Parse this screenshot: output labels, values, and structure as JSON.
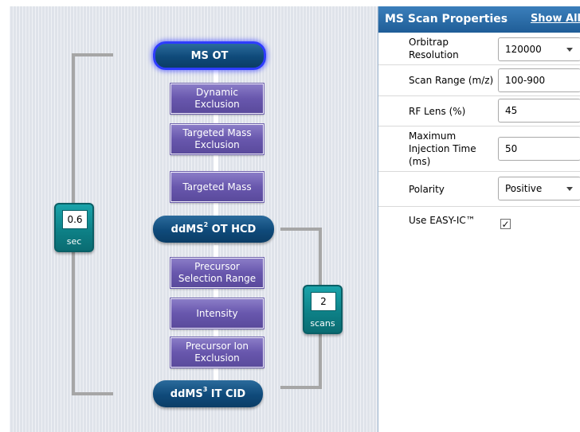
{
  "method_tree": {
    "ms_ot": "MS OT",
    "filters_top": [
      [
        "Dynamic",
        "Exclusion"
      ],
      [
        "Targeted Mass",
        "Exclusion"
      ],
      [
        "Targeted Mass"
      ]
    ],
    "dd_ms2": {
      "prefix": "ddMS",
      "sup": "2",
      "suffix": " OT HCD"
    },
    "filters_bottom": [
      [
        "Precursor",
        "Selection Range"
      ],
      [
        "Intensity"
      ],
      [
        "Precursor Ion",
        "Exclusion"
      ]
    ],
    "dd_ms3": {
      "prefix": "ddMS",
      "sup": "3",
      "suffix": " IT CID"
    },
    "cycle_time": {
      "value": "0.6",
      "unit": "sec"
    },
    "loop_count": {
      "value": "2",
      "unit": "scans"
    }
  },
  "properties_panel": {
    "title": "MS Scan Properties",
    "show_all": "Show All",
    "orbitrap_resolution": {
      "label": "Orbitrap Resolution",
      "value": "120000"
    },
    "scan_range": {
      "label": "Scan Range (m/z)",
      "value": "100-900"
    },
    "rf_lens": {
      "label": "RF Lens (%)",
      "value": "45"
    },
    "max_injection_time": {
      "label": "Maximum Injection Time (ms)",
      "value": "50"
    },
    "polarity": {
      "label": "Polarity",
      "value": "Positive"
    },
    "use_easy_ic": {
      "label": "Use EASY-IC™",
      "checked": true,
      "mark": "✓"
    }
  },
  "colors": {
    "node_blue": "#0f4a7a",
    "filter_purple": "#6857ad",
    "badge_teal": "#0d7f85",
    "header_blue": "#1f5d97",
    "selection_outline": "#2e3cff"
  }
}
